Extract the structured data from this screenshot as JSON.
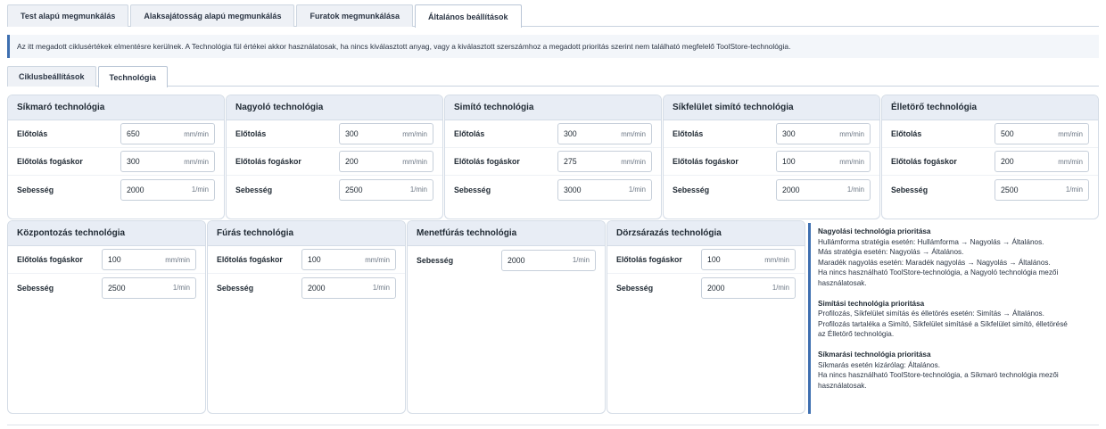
{
  "main_tabs": [
    {
      "label": "Test alapú megmunkálás",
      "active": false
    },
    {
      "label": "Alaksajátosság alapú megmunkálás",
      "active": false
    },
    {
      "label": "Furatok megmunkálása",
      "active": false
    },
    {
      "label": "Általános beállítások",
      "active": true
    }
  ],
  "info_text": "Az itt megadott ciklusértékek elmentésre kerülnek. A Technológia fül értékei akkor használatosak, ha nincs kiválasztott anyag, vagy a kiválasztott szerszámhoz a megadott prioritás szerint nem található megfelelő ToolStore-technológia.",
  "sub_tabs": [
    {
      "label": "Ciklusbeállítások",
      "active": false
    },
    {
      "label": "Technológia",
      "active": true
    }
  ],
  "panels_row1": [
    {
      "title": "Síkmaró technológia",
      "fields": [
        {
          "label": "Előtolás",
          "value": "650",
          "unit": "mm/min"
        },
        {
          "label": "Előtolás fogáskor",
          "value": "300",
          "unit": "mm/min"
        },
        {
          "label": "Sebesség",
          "value": "2000",
          "unit": "1/min"
        }
      ]
    },
    {
      "title": "Nagyoló technológia",
      "fields": [
        {
          "label": "Előtolás",
          "value": "300",
          "unit": "mm/min"
        },
        {
          "label": "Előtolás fogáskor",
          "value": "200",
          "unit": "mm/min"
        },
        {
          "label": "Sebesség",
          "value": "2500",
          "unit": "1/min"
        }
      ]
    },
    {
      "title": "Simító technológia",
      "fields": [
        {
          "label": "Előtolás",
          "value": "300",
          "unit": "mm/min"
        },
        {
          "label": "Előtolás fogáskor",
          "value": "275",
          "unit": "mm/min"
        },
        {
          "label": "Sebesség",
          "value": "3000",
          "unit": "1/min"
        }
      ]
    },
    {
      "title": "Síkfelület simító technológia",
      "fields": [
        {
          "label": "Előtolás",
          "value": "300",
          "unit": "mm/min"
        },
        {
          "label": "Előtolás fogáskor",
          "value": "100",
          "unit": "mm/min"
        },
        {
          "label": "Sebesség",
          "value": "2000",
          "unit": "1/min"
        }
      ]
    },
    {
      "title": "Élletörő technológia",
      "fields": [
        {
          "label": "Előtolás",
          "value": "500",
          "unit": "mm/min"
        },
        {
          "label": "Előtolás fogáskor",
          "value": "200",
          "unit": "mm/min"
        },
        {
          "label": "Sebesség",
          "value": "2500",
          "unit": "1/min"
        }
      ]
    }
  ],
  "panels_row2": [
    {
      "title": "Központozás technológia",
      "fields": [
        {
          "label": "Előtolás fogáskor",
          "value": "100",
          "unit": "mm/min"
        },
        {
          "label": "Sebesség",
          "value": "2500",
          "unit": "1/min"
        }
      ]
    },
    {
      "title": "Fúrás technológia",
      "fields": [
        {
          "label": "Előtolás fogáskor",
          "value": "100",
          "unit": "mm/min"
        },
        {
          "label": "Sebesség",
          "value": "2000",
          "unit": "1/min"
        }
      ]
    },
    {
      "title": "Menetfúrás technológia",
      "fields": [
        {
          "label": "Sebesség",
          "value": "2000",
          "unit": "1/min"
        }
      ]
    },
    {
      "title": "Dörzsárazás technológia",
      "fields": [
        {
          "label": "Előtolás fogáskor",
          "value": "100",
          "unit": "mm/min"
        },
        {
          "label": "Sebesség",
          "value": "2000",
          "unit": "1/min"
        }
      ]
    }
  ],
  "priority": [
    {
      "title": "Nagyolási technológia prioritása",
      "lines": [
        "Hullámforma stratégia esetén: Hullámforma → Nagyolás → Általános.",
        "Más stratégia esetén: Nagyolás → Általános.",
        "Maradék nagyolás esetén: Maradék nagyolás → Nagyolás → Általános.",
        "Ha nincs használható ToolStore-technológia, a Nagyoló technológia mezői",
        "használatosak."
      ]
    },
    {
      "title": "Simítási technológia prioritása",
      "lines": [
        "Profilozás, Síkfelület simítás és élletörés esetén: Simítás → Általános.",
        "Profilozás tartaléka a Simító, Síkfelület simításé a Síkfelület simító, élletörésé",
        "az Élletörő technológia."
      ]
    },
    {
      "title": "Síkmarási technológia prioritása",
      "lines": [
        "Síkmarás esetén kizárólag: Általános.",
        "Ha nincs használható ToolStore-technológia, a Síkmaró technológia mezői",
        "használatosak."
      ]
    }
  ]
}
